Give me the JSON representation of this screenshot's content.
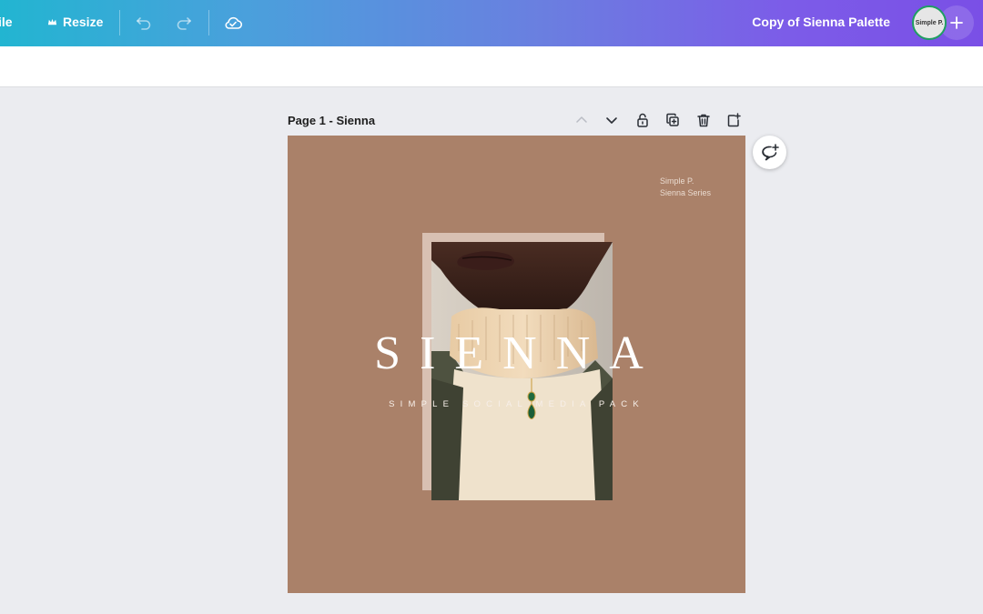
{
  "topbar": {
    "file_label": "ile",
    "resize_label": "Resize",
    "icons": [
      "crown-icon",
      "undo-icon",
      "redo-icon",
      "cloud-saved-icon",
      "plus-icon"
    ],
    "doc_title": "Copy of Sienna Palette",
    "avatar_text": "Simple P."
  },
  "page": {
    "title": "Page 1 - Sienna",
    "tools": [
      "chevron-up-icon",
      "chevron-down-icon",
      "lock-icon",
      "duplicate-icon",
      "trash-icon",
      "add-page-icon"
    ]
  },
  "design": {
    "brand_line1": "Simple P.",
    "brand_line2": "Sienna Series",
    "headline": "SIENNA",
    "subline": "SIMPLE SOCIAL MEDIA PACK",
    "background_color": "#aa8169"
  },
  "comment": {
    "icon": "add-comment-icon"
  }
}
